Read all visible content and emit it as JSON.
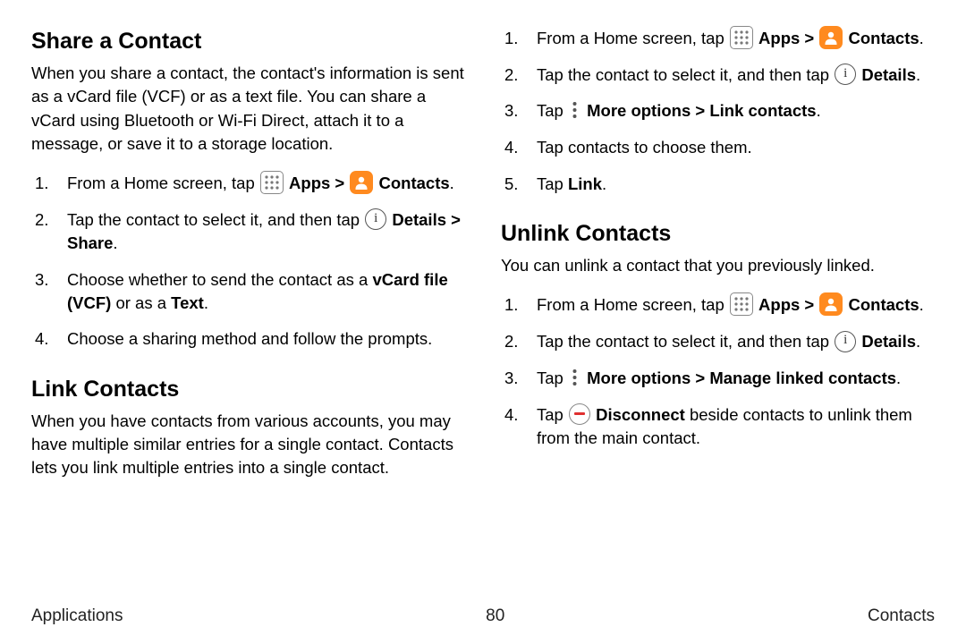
{
  "left": {
    "share_heading": "Share a Contact",
    "share_intro": "When you share a contact, the contact's information is sent as a vCard file (VCF) or as a text file. You can share a vCard using Bluetooth or Wi-Fi Direct, attach it to a message, or save it to a storage location.",
    "share_s1_a": "From a Home screen, tap ",
    "share_s1_apps": " Apps",
    "share_s1_chev": " > ",
    "share_s1_contacts": " Contacts",
    "share_s1_end": ".",
    "share_s2_a": "Tap the contact to select it, and then tap ",
    "share_s2_b": " Details > Share",
    "share_s2_end": ".",
    "share_s3_a": "Choose whether to send the contact as a ",
    "share_s3_b": "vCard file (VCF)",
    "share_s3_c": " or as a ",
    "share_s3_d": "Text",
    "share_s3_end": ".",
    "share_s4": "Choose a sharing method and follow the prompts.",
    "link_heading": "Link Contacts",
    "link_intro": "When you have contacts from various accounts, you may have multiple similar entries for a single contact. Contacts lets you link multiple entries into a single contact."
  },
  "right": {
    "link_s1_a": "From a Home screen, tap ",
    "link_s1_apps": " Apps",
    "link_s1_chev": " > ",
    "link_s1_contacts": " Contacts",
    "link_s1_end": ".",
    "link_s2_a": "Tap the contact to select it, and then tap ",
    "link_s2_b": " Details",
    "link_s2_end": ".",
    "link_s3_a": "Tap ",
    "link_s3_b": " More options > Link contacts",
    "link_s3_end": ".",
    "link_s4": "Tap contacts to choose them.",
    "link_s5_a": "Tap ",
    "link_s5_b": "Link",
    "link_s5_end": ".",
    "unlink_heading": "Unlink Contacts",
    "unlink_intro": "You can unlink a contact that you previously linked.",
    "unlink_s1_a": "From a Home screen, tap ",
    "unlink_s1_apps": " Apps",
    "unlink_s1_chev": " > ",
    "unlink_s1_contacts": " Contacts",
    "unlink_s1_end": ".",
    "unlink_s2_a": "Tap the contact to select it, and then tap ",
    "unlink_s2_b": " Details",
    "unlink_s2_end": ".",
    "unlink_s3_a": "Tap ",
    "unlink_s3_b": " More options > Manage linked contacts",
    "unlink_s3_end": ".",
    "unlink_s4_a": "Tap ",
    "unlink_s4_b": " Disconnect",
    "unlink_s4_c": " beside contacts to unlink them from the main contact."
  },
  "footer": {
    "left": "Applications",
    "center": "80",
    "right": "Contacts"
  }
}
